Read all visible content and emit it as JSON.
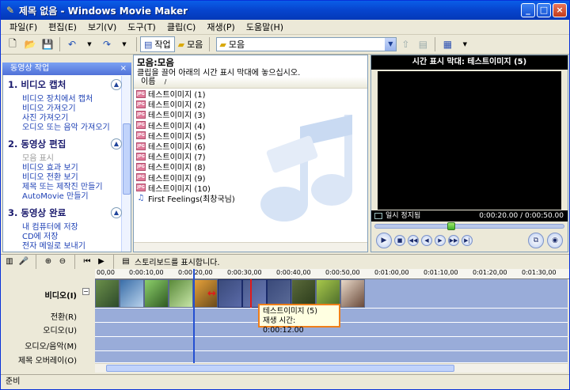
{
  "window": {
    "title": "제목 없음 - Windows Movie Maker"
  },
  "menubar": [
    "파일(F)",
    "편집(E)",
    "보기(V)",
    "도구(T)",
    "클립(C)",
    "재생(P)",
    "도움말(H)"
  ],
  "toolbar": {
    "tasks_label": "작업",
    "collections_label": "모음",
    "collection_value": "모음"
  },
  "taskpane": {
    "header": "동영상 작업",
    "close": "×",
    "sections": [
      {
        "title": "1. 비디오 캡처",
        "items": [
          "비디오 장치에서 캡처",
          "비디오 가져오기",
          "사진 가져오기",
          "오디오 또는 음악 가져오기"
        ],
        "disabled": []
      },
      {
        "title": "2. 동영상 편집",
        "items": [
          "모음 표시",
          "비디오 효과 보기",
          "비디오 전환 보기",
          "제목 또는 제작진 만들기",
          "AutoMovie 만들기"
        ],
        "disabled": [
          0
        ]
      },
      {
        "title": "3. 동영상 완료",
        "items": [
          "내 컴퓨터에 저장",
          "CD에 저장",
          "전자 메일로 보내기"
        ],
        "disabled": []
      }
    ]
  },
  "contents": {
    "title": "모음:모음",
    "subtitle": "클립을 끌어 아래의 시간 표시 막대에 놓으십시오.",
    "column": "이름",
    "clips": [
      {
        "name": "테스트이미지 (1)",
        "icon": "jpg-icon"
      },
      {
        "name": "테스트이미지 (2)",
        "icon": "jpg-icon"
      },
      {
        "name": "테스트이미지 (3)",
        "icon": "jpg-icon"
      },
      {
        "name": "테스트이미지 (4)",
        "icon": "jpg-icon"
      },
      {
        "name": "테스트이미지 (5)",
        "icon": "jpg-icon"
      },
      {
        "name": "테스트이미지 (6)",
        "icon": "jpg-icon"
      },
      {
        "name": "테스트이미지 (7)",
        "icon": "jpg-icon"
      },
      {
        "name": "테스트이미지 (8)",
        "icon": "jpg-icon"
      },
      {
        "name": "테스트이미지 (9)",
        "icon": "jpg-icon"
      },
      {
        "name": "테스트이미지 (10)",
        "icon": "jpg-icon"
      },
      {
        "name": "First Feelings(최창국님)",
        "icon": "audio-icon"
      }
    ]
  },
  "monitor": {
    "title": "시간 표시 막대: 테스트이미지 (5)",
    "status": "일시 정지됨",
    "time": "0:00:20.00 / 0:00:50.00",
    "seek_fraction": 0.4
  },
  "storyboard": {
    "toggle_label": "스토리보드를 표시합니다."
  },
  "timeline": {
    "ruler": [
      "00,00",
      "0:00:10,00",
      "0:00:20,00",
      "0:00:30,00",
      "0:00:40,00",
      "0:00:50,00",
      "0:01:00,00",
      "0:01:10,00",
      "0:01:20,00",
      "0:01:30,00"
    ],
    "tracks": {
      "video": "비디오(I)",
      "transition": "전환(R)",
      "audio": "오디오(U)",
      "audio_music": "오디오/음악(M)",
      "title_overlay": "제목 오버레이(O)"
    },
    "callout": {
      "line1": "테스트이미지 (5)",
      "line2": "재생 시간:  0:00:12.00"
    }
  },
  "statusbar": {
    "text": "준비"
  }
}
